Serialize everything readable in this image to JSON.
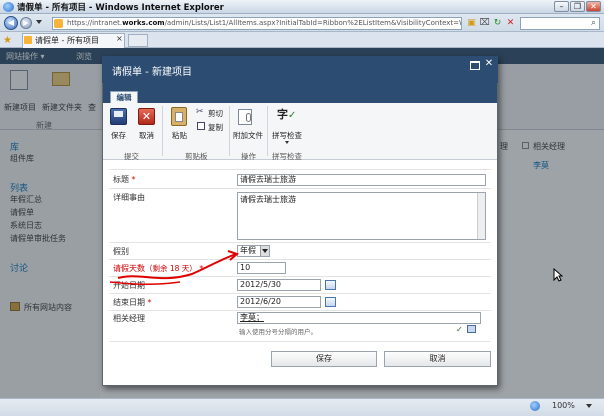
{
  "window": {
    "title": "请假单 - 所有项目 - Windows Internet Explorer",
    "url_prefix": "https://intranet.",
    "url_domain": "works.com",
    "url_rest": "/admin/Lists/List1/AllItems.aspx?InitialTabId=Ribbon%2EListItem&VisibilityContext=WSSTabPersistence",
    "tab_title": "请假单 - 所有项目",
    "controls": {
      "minimize": "–",
      "restore": "❐",
      "close": "✕"
    }
  },
  "background": {
    "ribbon_top": [
      "网站操作 ▾",
      "浏览"
    ],
    "ribbon_buttons": [
      "新建项目",
      "新建文件夹",
      "查"
    ],
    "ribbon_group": "新建",
    "nav": [
      {
        "label": "库",
        "type": "head"
      },
      {
        "label": "组件库",
        "type": "link"
      },
      {
        "label": "列表",
        "type": "head"
      },
      {
        "label": "年假汇总",
        "type": "link"
      },
      {
        "label": "请假单",
        "type": "link"
      },
      {
        "label": "系统日志",
        "type": "link"
      },
      {
        "label": "请假单审批任务",
        "type": "link"
      },
      {
        "label": "讨论",
        "type": "head"
      },
      {
        "label": "所有网站内容",
        "type": "link"
      }
    ],
    "right_col1": "理",
    "right_col2": "相关经理",
    "right_value": "李莫"
  },
  "dialog": {
    "title": "请假单 - 新建项目",
    "ribbon_tab": "编辑",
    "buttons": {
      "save": "保存",
      "cancel": "取消",
      "paste": "粘贴",
      "cut": "剪切",
      "copy": "复制",
      "attach": "附加文件",
      "spell": "拼写检查"
    },
    "groups": {
      "commit": "提交",
      "clipboard": "剪贴板",
      "actions": "操作",
      "spelling": "拼写检查"
    },
    "fields": {
      "title_label": "标题",
      "title_value": "请假去瑞士旅游",
      "detail_label": "详细事由",
      "detail_value": "请假去瑞士旅游",
      "type_label": "假别",
      "type_value": "年假",
      "days_label": "请假天数",
      "days_remaining": "（剩余 18 天）",
      "days_value": "10",
      "start_label": "开始日期",
      "start_value": "2012/5/30",
      "end_label": "结束日期",
      "end_value": "2012/6/20",
      "manager_label": "相关经理",
      "manager_value": "李莫；",
      "manager_hint": "输入使用分号分隔的用户。",
      "required_mark": "*"
    },
    "save_button": "保存",
    "cancel_button": "取消"
  },
  "status": {
    "zoom": "100%"
  },
  "colors": {
    "sp_blue": "#2c4d71",
    "annotation": "#e00000"
  }
}
